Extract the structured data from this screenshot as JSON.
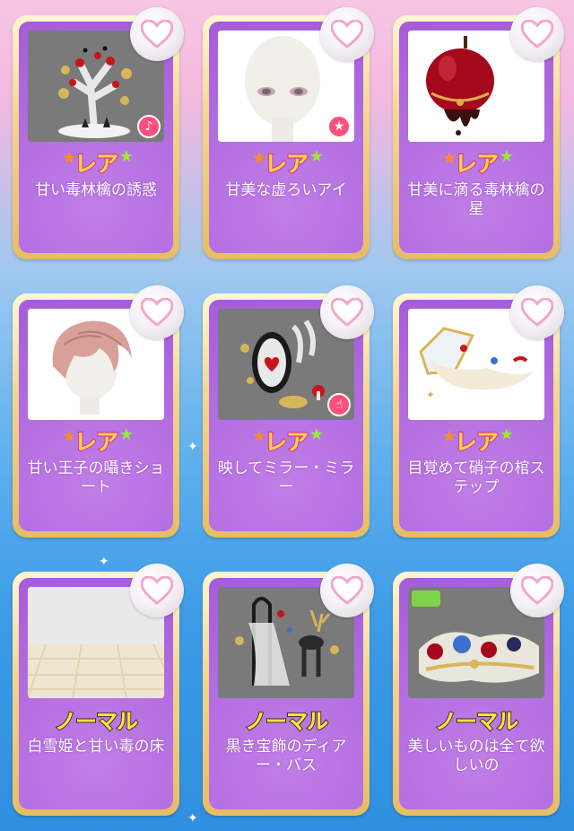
{
  "items": [
    {
      "name": "甘い毒林檎の誘惑",
      "rarity": "レア",
      "rarity_type": "rare",
      "badge": "music-note-icon",
      "thumb": "tree"
    },
    {
      "name": "甘美な虚ろいアイ",
      "rarity": "レア",
      "rarity_type": "rare",
      "badge": "star-icon",
      "thumb": "face"
    },
    {
      "name": "甘美に滴る毒林檎の星",
      "rarity": "レア",
      "rarity_type": "rare",
      "badge": "",
      "thumb": "apple"
    },
    {
      "name": "甘い王子の囁きショート",
      "rarity": "レア",
      "rarity_type": "rare",
      "badge": "",
      "thumb": "hair"
    },
    {
      "name": "映してミラー・ミラー",
      "rarity": "レア",
      "rarity_type": "rare",
      "badge": "tap-hand-icon",
      "thumb": "mirror"
    },
    {
      "name": "目覚めて硝子の棺ステップ",
      "rarity": "レア",
      "rarity_type": "rare",
      "badge": "",
      "thumb": "coffin"
    },
    {
      "name": "白雪姫と甘い毒の床",
      "rarity": "ノーマル",
      "rarity_type": "normal",
      "badge": "",
      "thumb": "floor"
    },
    {
      "name": "黒き宝飾のディアー・バス",
      "rarity": "ノーマル",
      "rarity_type": "normal",
      "badge": "",
      "thumb": "deer"
    },
    {
      "name": "美しいものは全て欲しいの",
      "rarity": "ノーマル",
      "rarity_type": "normal",
      "badge": "",
      "thumb": "jewels"
    }
  ],
  "colors": {
    "card_purple": "#b06ae0",
    "card_gold": "#e8bd63",
    "rare_text": "#ffd43a",
    "rare_outline": "#d42a90",
    "normal_text": "#ffe33d",
    "badge_pink": "#ff4f7a",
    "heart_pink": "#f7b0cf"
  }
}
